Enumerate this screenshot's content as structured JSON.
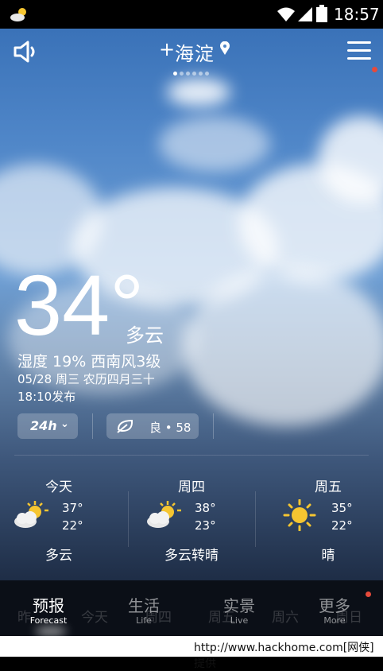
{
  "status_bar": {
    "time": "18:57"
  },
  "header": {
    "city_prefix": "+",
    "city": "海淀",
    "page_dots": 6,
    "active_dot": 0
  },
  "current": {
    "temperature": "34°",
    "condition": "多云",
    "humidity_wind": "湿度 19% 西南风3级",
    "date_line": "05/28 周三 农历四月三十",
    "publish_time": "18:10发布"
  },
  "controls": {
    "hours_label": "24h",
    "aqi_label": "良 • 58"
  },
  "forecast": [
    {
      "day": "今天",
      "high": "37°",
      "low": "22°",
      "condition": "多云",
      "icon": "partly-cloudy-icon"
    },
    {
      "day": "周四",
      "high": "38°",
      "low": "23°",
      "condition": "多云转晴",
      "icon": "partly-cloudy-icon"
    },
    {
      "day": "周五",
      "high": "35°",
      "low": "22°",
      "condition": "晴",
      "icon": "sun-icon"
    }
  ],
  "tabs": [
    {
      "zh": "预报",
      "en": "Forecast"
    },
    {
      "zh": "生活",
      "en": "Life"
    },
    {
      "zh": "实景",
      "en": "Live"
    },
    {
      "zh": "更多",
      "en": "More"
    }
  ],
  "ghost_days": [
    "昨",
    "今天",
    "周四",
    "周五",
    "周六",
    "周日"
  ],
  "footer": "http://www.hackhome.com[网侠]提供",
  "colors": {
    "accent_dot": "#e64a3b",
    "sun": "#f5c531",
    "tabbar": "#0b0f17"
  }
}
